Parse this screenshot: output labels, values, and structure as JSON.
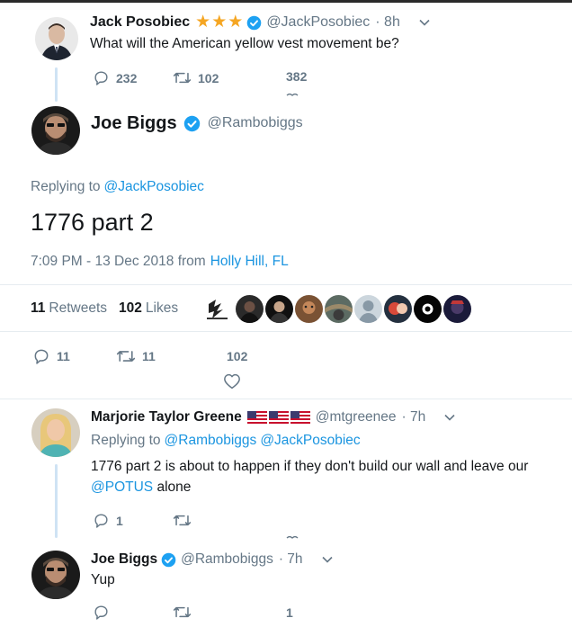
{
  "tweet1": {
    "name": "Jack Posobiec",
    "stars": [
      "★",
      "★",
      "★"
    ],
    "handle": "@JackPosobiec",
    "time": "· 8h",
    "text": "What will the American yellow vest movement be?",
    "replies": "232",
    "retweets": "102",
    "likes": "382"
  },
  "main": {
    "name": "Joe Biggs",
    "handle": "@Rambobiggs",
    "replying_prefix": "Replying to",
    "replying_to": "@JackPosobiec",
    "text": "1776 part 2",
    "timestamp": "7:09 PM - 13 Dec 2018 from",
    "location": "Holly Hill, FL",
    "retweets_count": "11",
    "retweets_label": "Retweets",
    "likes_count": "102",
    "likes_label": "Likes",
    "replies": "11",
    "retweets": "11",
    "likes": "102"
  },
  "reply1": {
    "name": "Marjorie Taylor Greene",
    "handle": "@mtgreenee",
    "time": "· 7h",
    "replying_prefix": "Replying to",
    "replying_to_1": "@Rambobiggs",
    "replying_to_2": "@JackPosobiec",
    "text_line1": "1776 part 2 is about to happen if they don't build our wall and leave our",
    "mention": "@POTUS",
    "text_line2_rest": " alone",
    "replies": "1"
  },
  "reply2": {
    "name": "Joe Biggs",
    "handle": "@Rambobiggs",
    "time": "· 7h",
    "text": "Yup",
    "likes": "1"
  },
  "colors": {
    "accent": "#1b95e0",
    "muted": "#657786",
    "star": "#f5a623",
    "thread": "#cfe3f4"
  }
}
